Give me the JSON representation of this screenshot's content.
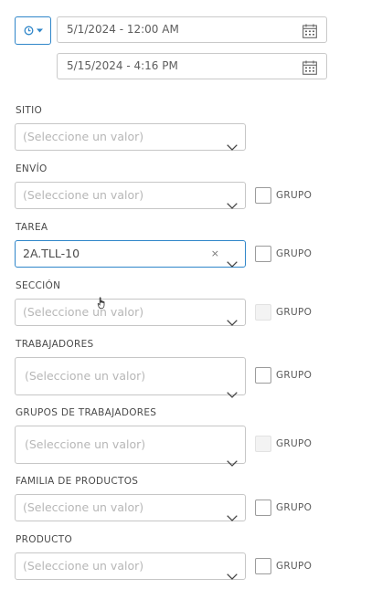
{
  "time_range": {
    "mode_icon": "clock-icon",
    "start": "5/1/2024 - 12:00 AM",
    "end": "5/15/2024 - 4:16 PM"
  },
  "filters": {
    "sitio": {
      "label": "SITIO",
      "placeholder": "(Seleccione un valor)"
    },
    "envio": {
      "label": "ENVÍO",
      "placeholder": "(Seleccione un valor)",
      "group_label": "GRUPO"
    },
    "tarea": {
      "label": "TAREA",
      "value": "2A.TLL-10",
      "clear": "×",
      "group_label": "GRUPO"
    },
    "seccion": {
      "label": "SECCIÓN",
      "placeholder": "(Seleccione un valor)",
      "group_label": "GRUPO"
    },
    "trabajadores": {
      "label": "TRABAJADORES",
      "placeholder": "(Seleccione un valor)",
      "group_label": "GRUPO"
    },
    "grupos_trabajadores": {
      "label": "GRUPOS DE TRABAJADORES",
      "placeholder": "(Seleccione un valor)",
      "group_label": "GRUPO"
    },
    "familia_productos": {
      "label": "FAMILIA DE PRODUCTOS",
      "placeholder": "(Seleccione un valor)",
      "group_label": "GRUPO"
    },
    "producto": {
      "label": "PRODUCTO",
      "placeholder": "(Seleccione un valor)",
      "group_label": "GRUPO"
    }
  },
  "colors": {
    "accent": "#2f86c9",
    "border": "#c6c6c6",
    "placeholder": "#b7b7b7"
  }
}
